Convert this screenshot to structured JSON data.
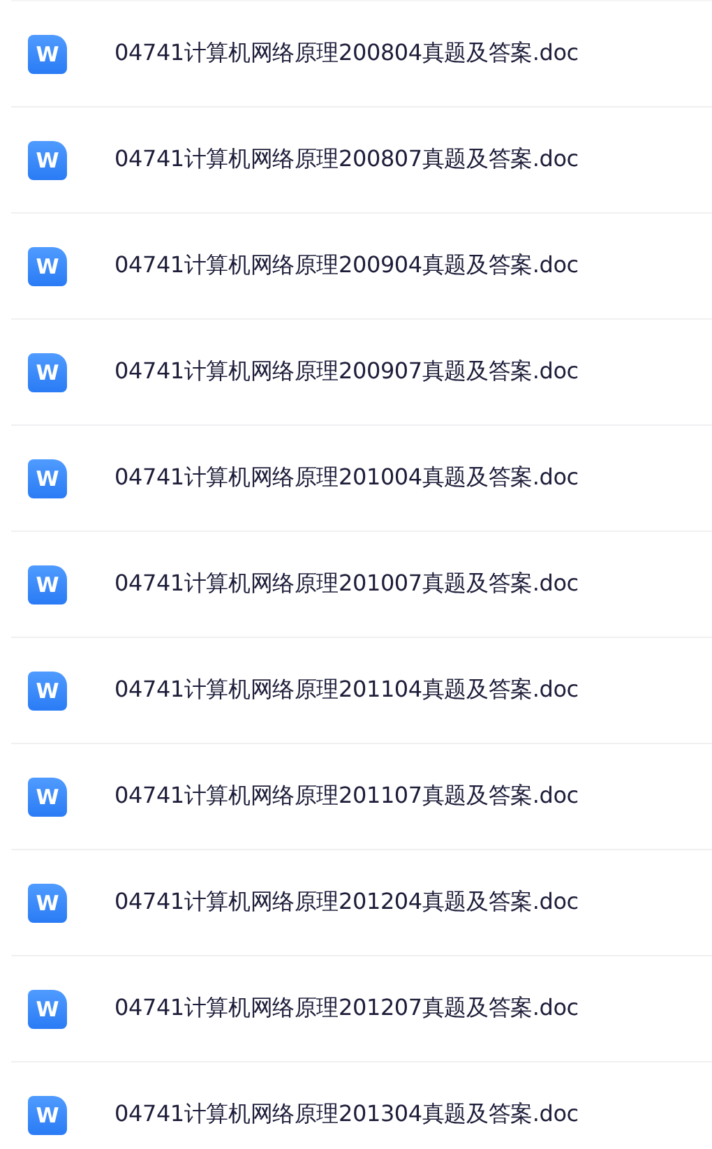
{
  "files": [
    {
      "name": "04741计算机网络原理200804真题及答案.doc",
      "icon_label": "W"
    },
    {
      "name": "04741计算机网络原理200807真题及答案.doc",
      "icon_label": "W"
    },
    {
      "name": "04741计算机网络原理200904真题及答案.doc",
      "icon_label": "W"
    },
    {
      "name": "04741计算机网络原理200907真题及答案.doc",
      "icon_label": "W"
    },
    {
      "name": "04741计算机网络原理201004真题及答案.doc",
      "icon_label": "W"
    },
    {
      "name": "04741计算机网络原理201007真题及答案.doc",
      "icon_label": "W"
    },
    {
      "name": "04741计算机网络原理201104真题及答案.doc",
      "icon_label": "W"
    },
    {
      "name": "04741计算机网络原理201107真题及答案.doc",
      "icon_label": "W"
    },
    {
      "name": "04741计算机网络原理201204真题及答案.doc",
      "icon_label": "W"
    },
    {
      "name": "04741计算机网络原理201207真题及答案.doc",
      "icon_label": "W"
    },
    {
      "name": "04741计算机网络原理201304真题及答案.doc",
      "icon_label": "W"
    }
  ]
}
